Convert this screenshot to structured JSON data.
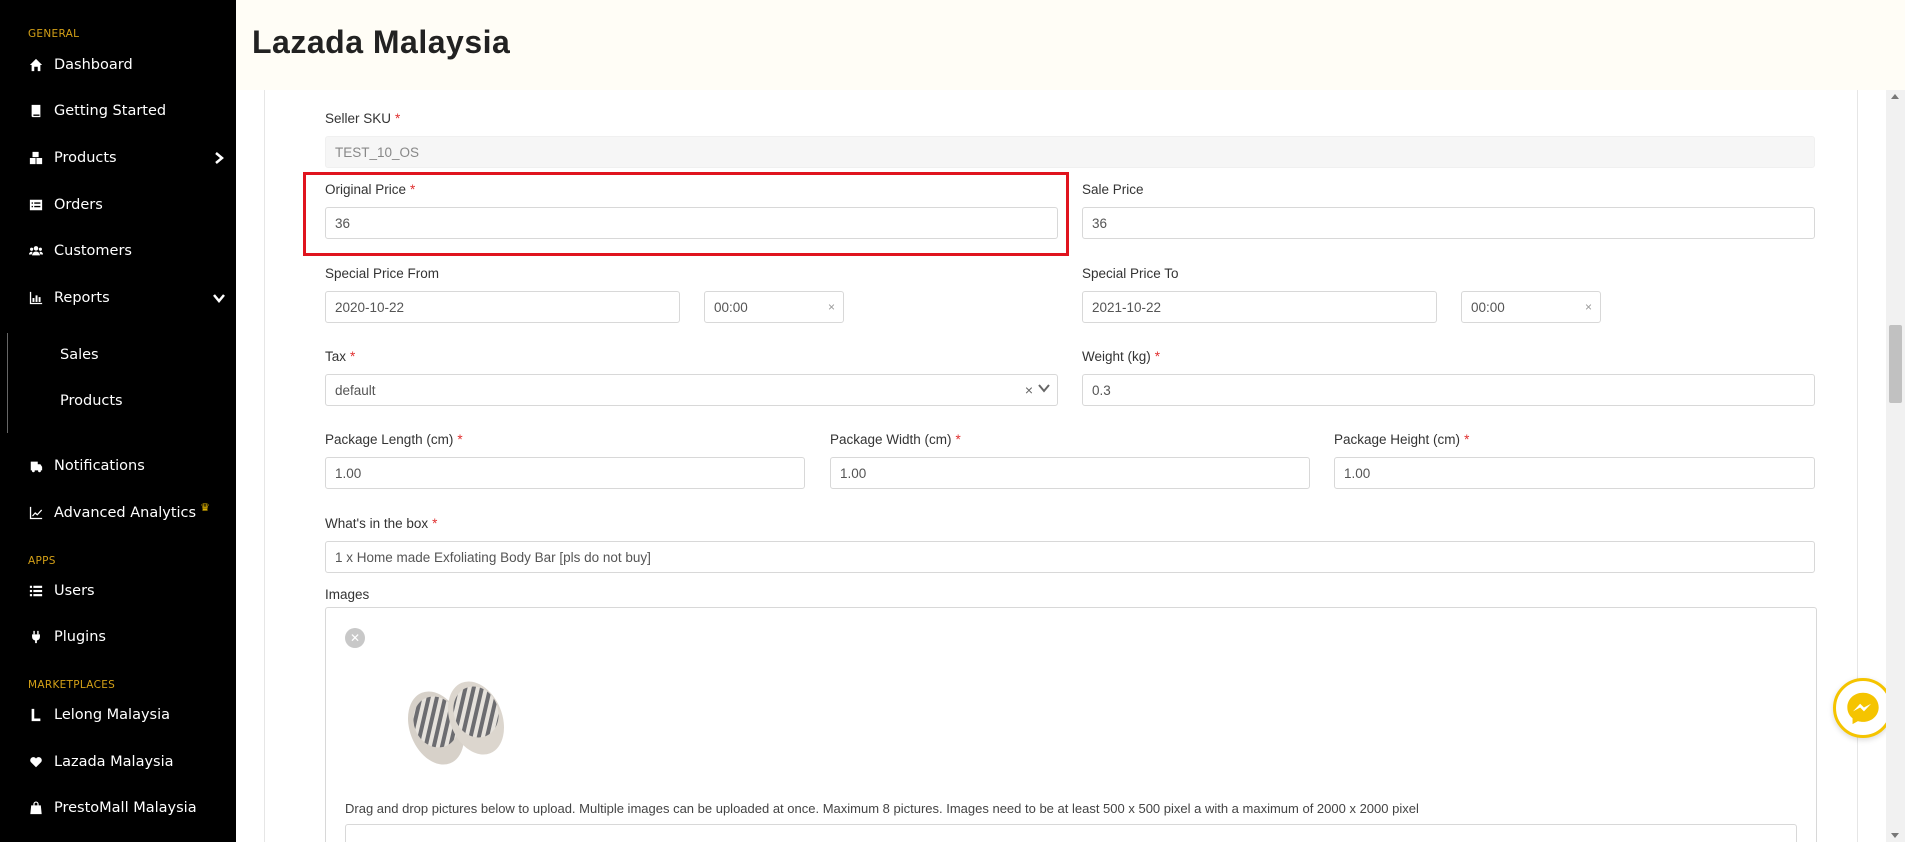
{
  "sidebar": {
    "sections": {
      "general": "GENERAL",
      "apps": "APPS",
      "marketplaces": "MARKETPLACES"
    },
    "items": {
      "dashboard": "Dashboard",
      "getting_started": "Getting Started",
      "products": "Products",
      "orders": "Orders",
      "customers": "Customers",
      "reports": "Reports",
      "reports_sales": "Sales",
      "reports_products": "Products",
      "notifications": "Notifications",
      "advanced_analytics": "Advanced Analytics",
      "users": "Users",
      "plugins": "Plugins",
      "lelong": "Lelong Malaysia",
      "lazada": "Lazada Malaysia",
      "prestomall": "PrestoMall Malaysia"
    }
  },
  "header": {
    "title": "Lazada Malaysia"
  },
  "form": {
    "seller_sku": {
      "label": "Seller SKU",
      "value": "TEST_10_OS"
    },
    "original_price": {
      "label": "Original Price",
      "value": "36"
    },
    "sale_price": {
      "label": "Sale Price",
      "value": "36"
    },
    "special_from": {
      "label": "Special Price From",
      "date": "2020-10-22",
      "time": "00:00"
    },
    "special_to": {
      "label": "Special Price To",
      "date": "2021-10-22",
      "time": "00:00"
    },
    "tax": {
      "label": "Tax",
      "value": "default"
    },
    "weight": {
      "label": "Weight (kg)",
      "value": "0.3"
    },
    "pkg_length": {
      "label": "Package Length (cm)",
      "value": "1.00"
    },
    "pkg_width": {
      "label": "Package Width (cm)",
      "value": "1.00"
    },
    "pkg_height": {
      "label": "Package Height (cm)",
      "value": "1.00"
    },
    "in_box": {
      "label": "What's in the box",
      "value": "1 x Home made Exfoliating Body Bar [pls do not buy]"
    },
    "images": {
      "label": "Images",
      "hint": "Drag and drop pictures below to upload. Multiple images can be uploaded at once. Maximum 8 pictures. Images need to be at least 500 x 500 pixel a with a maximum of 2000 x 2000 pixel"
    },
    "required_mark": "*",
    "clear_glyph": "×"
  },
  "colors": {
    "sidebar_bg": "#000000",
    "section_label": "#d4a017",
    "highlight": "#e0141e",
    "messenger_ring": "#f5c400"
  },
  "icons": [
    "home-icon",
    "book-icon",
    "boxes-icon",
    "orders-icon",
    "customers-icon",
    "chart-bar-icon",
    "notifications-icon",
    "line-chart-icon",
    "list-icon",
    "plug-icon",
    "lelong-icon",
    "heart-icon",
    "bag-icon",
    "messenger-icon"
  ]
}
